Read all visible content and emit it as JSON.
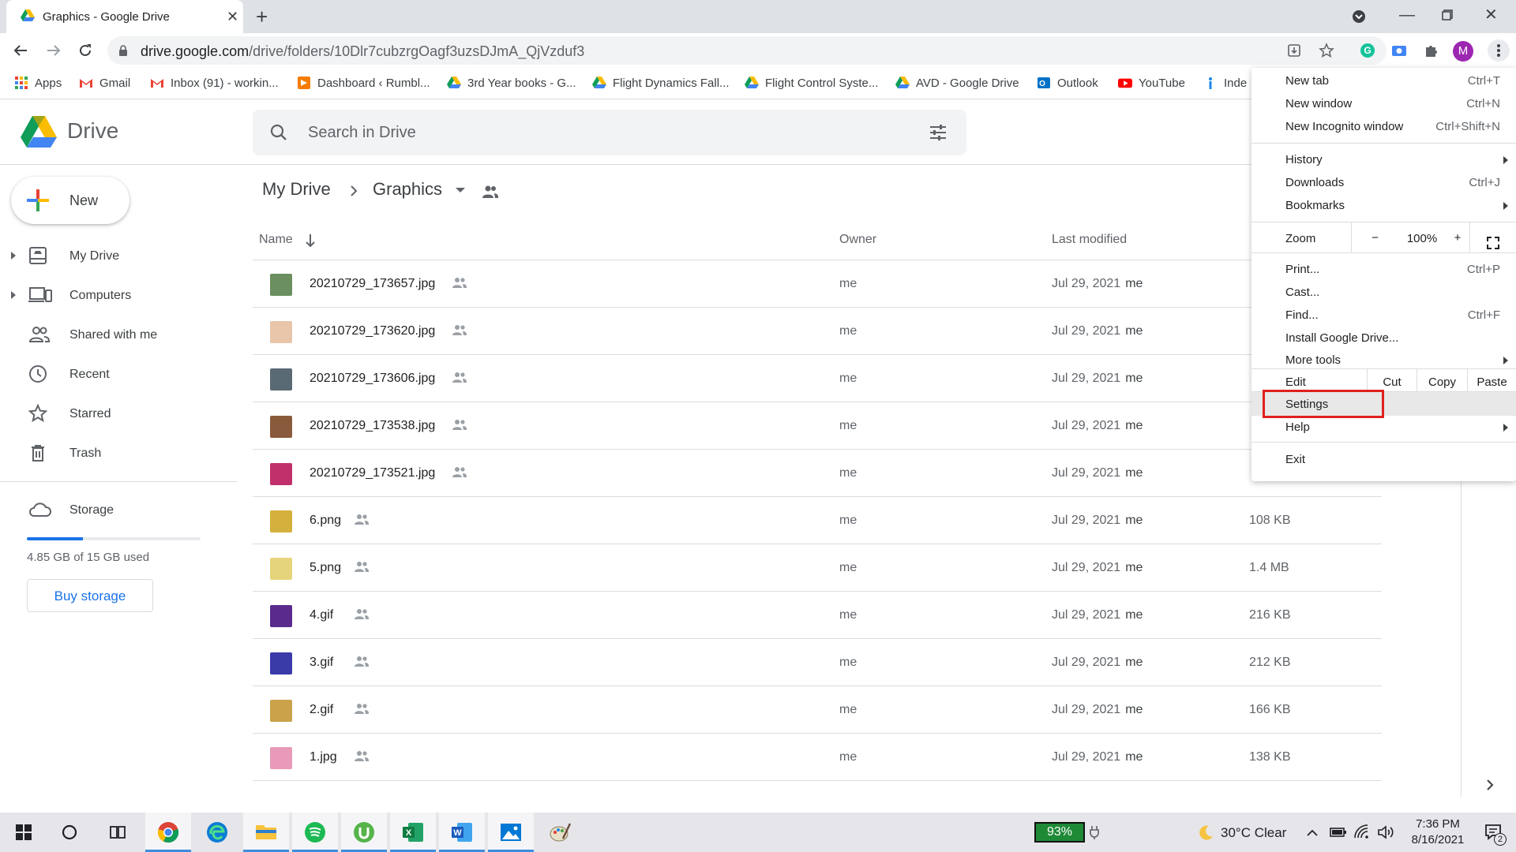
{
  "browser": {
    "tab_title": "Graphics - Google Drive",
    "url_host": "drive.google.com",
    "url_path": "/drive/folders/10Dlr7cubzrgOagf3uzsDJmA_QjVzduf3",
    "profile_initial": "M",
    "bookmarks": [
      "Apps",
      "Gmail",
      "Inbox (91) - workin...",
      "Dashboard ‹ Rumbl...",
      "3rd Year books - G...",
      "Flight Dynamics Fall...",
      "Flight Control Syste...",
      "AVD - Google Drive",
      "Outlook",
      "YouTube",
      "Inde"
    ]
  },
  "drive": {
    "logo": "Drive",
    "search_placeholder": "Search in Drive",
    "new_label": "New",
    "nav": [
      "My Drive",
      "Computers",
      "Shared with me",
      "Recent",
      "Starred",
      "Trash"
    ],
    "storage_label": "Storage",
    "storage_used_fraction": 0.323,
    "storage_text": "4.85 GB of 15 GB used",
    "buy_storage": "Buy storage",
    "breadcrumb_root": "My Drive",
    "breadcrumb_current": "Graphics",
    "columns": {
      "name": "Name",
      "owner": "Owner",
      "modified": "Last modified"
    },
    "files": [
      {
        "name": "20210729_173657.jpg",
        "owner": "me",
        "date": "Jul 29, 2021",
        "by": "me",
        "size": "",
        "color": "#6b8f5e"
      },
      {
        "name": "20210729_173620.jpg",
        "owner": "me",
        "date": "Jul 29, 2021",
        "by": "me",
        "size": "",
        "color": "#e9c6a9"
      },
      {
        "name": "20210729_173606.jpg",
        "owner": "me",
        "date": "Jul 29, 2021",
        "by": "me",
        "size": "",
        "color": "#5a6a74"
      },
      {
        "name": "20210729_173538.jpg",
        "owner": "me",
        "date": "Jul 29, 2021",
        "by": "me",
        "size": "",
        "color": "#8a5a3c"
      },
      {
        "name": "20210729_173521.jpg",
        "owner": "me",
        "date": "Jul 29, 2021",
        "by": "me",
        "size": "",
        "color": "#c0306a"
      },
      {
        "name": "6.png",
        "owner": "me",
        "date": "Jul 29, 2021",
        "by": "me",
        "size": "108 KB",
        "color": "#d4b13c"
      },
      {
        "name": "5.png",
        "owner": "me",
        "date": "Jul 29, 2021",
        "by": "me",
        "size": "1.4 MB",
        "color": "#e6d47a"
      },
      {
        "name": "4.gif",
        "owner": "me",
        "date": "Jul 29, 2021",
        "by": "me",
        "size": "216 KB",
        "color": "#5a2a8c"
      },
      {
        "name": "3.gif",
        "owner": "me",
        "date": "Jul 29, 2021",
        "by": "me",
        "size": "212 KB",
        "color": "#3a3aa8"
      },
      {
        "name": "2.gif",
        "owner": "me",
        "date": "Jul 29, 2021",
        "by": "me",
        "size": "166 KB",
        "color": "#c9a24a"
      },
      {
        "name": "1.jpg",
        "owner": "me",
        "date": "Jul 29, 2021",
        "by": "me",
        "size": "138 KB",
        "color": "#e89ab8"
      }
    ]
  },
  "menu": {
    "new_tab": "New tab",
    "new_tab_sc": "Ctrl+T",
    "new_window": "New window",
    "new_window_sc": "Ctrl+N",
    "incognito": "New Incognito window",
    "incognito_sc": "Ctrl+Shift+N",
    "history": "History",
    "downloads": "Downloads",
    "downloads_sc": "Ctrl+J",
    "bookmarks": "Bookmarks",
    "zoom": "Zoom",
    "zoom_minus": "−",
    "zoom_value": "100%",
    "zoom_plus": "+",
    "print": "Print...",
    "print_sc": "Ctrl+P",
    "cast": "Cast...",
    "find": "Find...",
    "find_sc": "Ctrl+F",
    "install": "Install Google Drive...",
    "more_tools": "More tools",
    "edit": "Edit",
    "cut": "Cut",
    "copy": "Copy",
    "paste": "Paste",
    "settings": "Settings",
    "help": "Help",
    "exit": "Exit"
  },
  "taskbar": {
    "battery": "93%",
    "weather": "30°C  Clear",
    "time": "7:36 PM",
    "date": "8/16/2021",
    "notifications": "2"
  }
}
